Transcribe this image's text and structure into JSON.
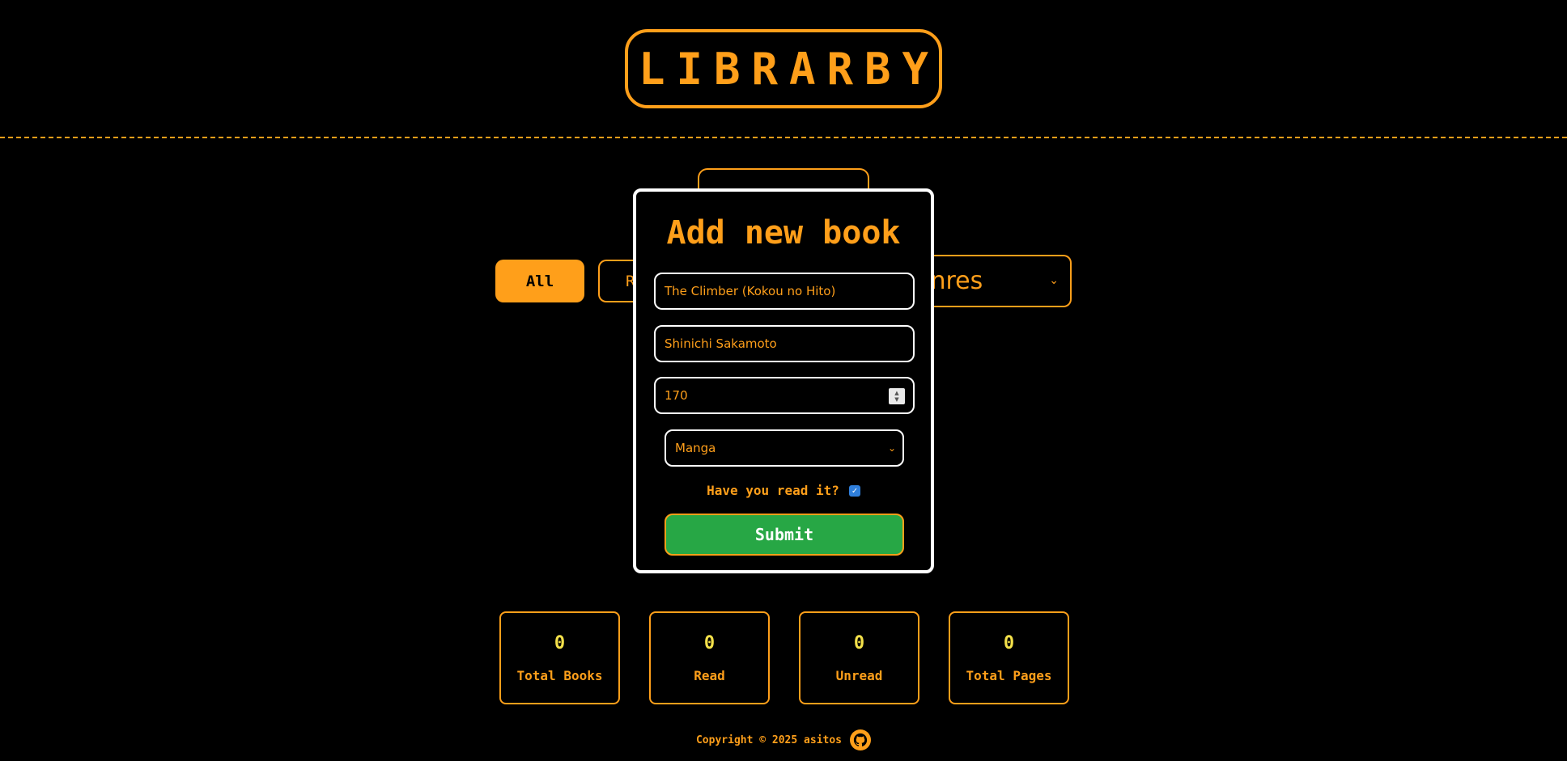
{
  "header": {
    "logo": "LIBRARBY"
  },
  "filters": {
    "all_label": "All",
    "read_label_visible": "R",
    "genre_select_visible": "enres"
  },
  "modal": {
    "title": "Add new book",
    "title_value": "The Climber (Kokou no Hito)",
    "author_value": "Shinichi Sakamoto",
    "pages_value": "170",
    "genre_value": "Manga",
    "read_label": "Have you read it?",
    "read_checked": true,
    "submit_label": "Submit"
  },
  "stats": [
    {
      "value": "0",
      "label": "Total Books"
    },
    {
      "value": "0",
      "label": "Read"
    },
    {
      "value": "0",
      "label": "Unread"
    },
    {
      "value": "0",
      "label": "Total Pages"
    }
  ],
  "footer": {
    "copyright": "Copyright © 2025 asitos"
  },
  "colors": {
    "accent": "#ff9f1a",
    "submit": "#27a745",
    "stat_number": "#f4e14a",
    "background": "#000000"
  }
}
